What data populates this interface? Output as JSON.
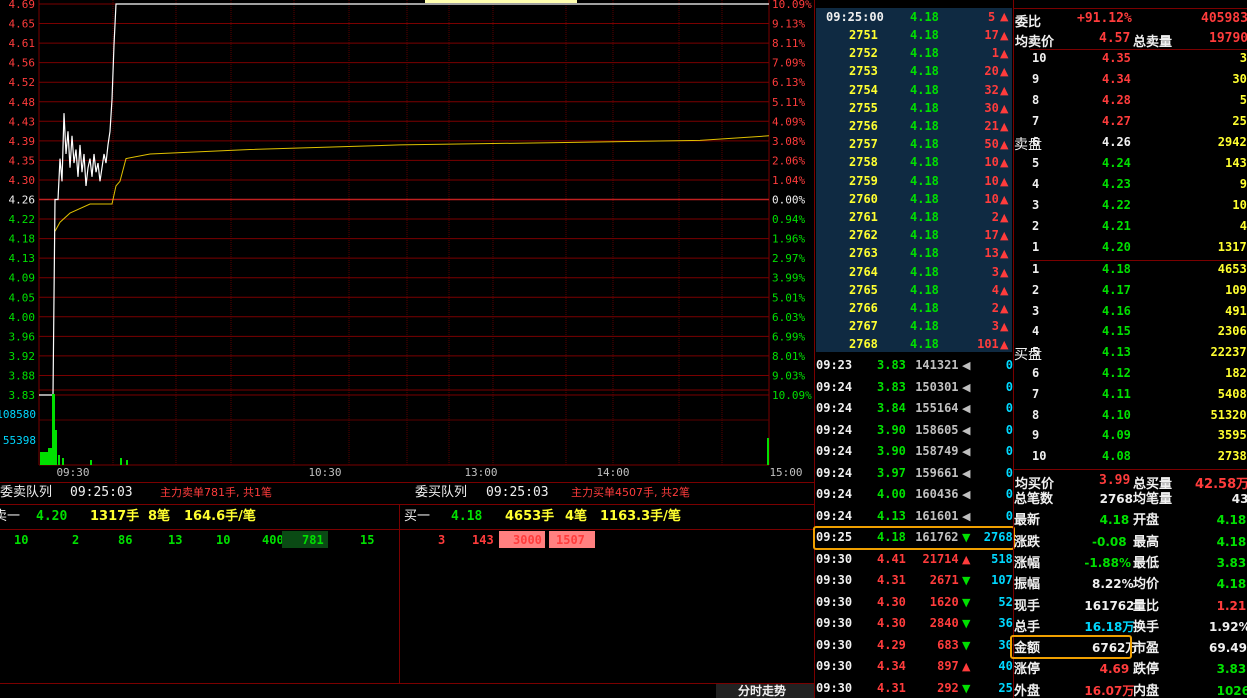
{
  "chart": {
    "left_prices": [
      "4.69",
      "4.65",
      "4.61",
      "4.56",
      "4.52",
      "4.48",
      "4.43",
      "4.39",
      "4.35",
      "4.30",
      "4.26",
      "4.22",
      "4.18",
      "4.13",
      "4.09",
      "4.05",
      "4.00",
      "3.96",
      "3.92",
      "3.88",
      "3.83"
    ],
    "right_pcts": [
      "10.09%",
      "9.13%",
      "8.11%",
      "7.09%",
      "6.13%",
      "5.11%",
      "4.09%",
      "3.08%",
      "2.06%",
      "1.04%",
      "0.00%",
      "0.94%",
      "1.96%",
      "2.97%",
      "3.99%",
      "5.01%",
      "6.03%",
      "6.99%",
      "8.01%",
      "9.03%",
      "10.09%"
    ],
    "vol_labels": [
      "108580",
      "55398"
    ],
    "time_labels": [
      "09:30",
      "10:30",
      "13:00",
      "14:00",
      "15:00"
    ],
    "prev_close": 4.26,
    "price_range": [
      3.83,
      4.69
    ]
  },
  "sell_queue": {
    "title": "委卖队列",
    "time": "09:25:03",
    "note": "主力卖单781手, 共1笔",
    "label": "卖一",
    "price": "4.20",
    "qty": "1317手",
    "count": "8笔",
    "avg": "164.6手/笔",
    "orders": [
      "10",
      "2",
      "86",
      "13",
      "10",
      "400",
      "781",
      "15"
    ]
  },
  "buy_queue": {
    "title": "委买队列",
    "time": "09:25:03",
    "note": "主力买单4507手, 共2笔",
    "label": "买一",
    "price": "4.18",
    "qty": "4653手",
    "count": "4笔",
    "avg": "1163.3手/笔",
    "orders": [
      "3",
      "143",
      "3000",
      "1507"
    ]
  },
  "trades_top": {
    "header_time": "09:25:00",
    "header_price": "4.18",
    "header_vol": "5",
    "rows": [
      [
        "2751",
        "4.18",
        "17"
      ],
      [
        "2752",
        "4.18",
        "1"
      ],
      [
        "2753",
        "4.18",
        "20"
      ],
      [
        "2754",
        "4.18",
        "32"
      ],
      [
        "2755",
        "4.18",
        "30"
      ],
      [
        "2756",
        "4.18",
        "21"
      ],
      [
        "2757",
        "4.18",
        "50"
      ],
      [
        "2758",
        "4.18",
        "10"
      ],
      [
        "2759",
        "4.18",
        "10"
      ],
      [
        "2760",
        "4.18",
        "10"
      ],
      [
        "2761",
        "4.18",
        "2"
      ],
      [
        "2762",
        "4.18",
        "17"
      ],
      [
        "2763",
        "4.18",
        "13"
      ],
      [
        "2764",
        "4.18",
        "3"
      ],
      [
        "2765",
        "4.18",
        "4"
      ],
      [
        "2766",
        "4.18",
        "2"
      ],
      [
        "2767",
        "4.18",
        "3"
      ],
      [
        "2768",
        "4.18",
        "101"
      ]
    ]
  },
  "trades_bottom": [
    {
      "time": "09:23",
      "price": "3.83",
      "vol": "141321",
      "dir": "left",
      "n": "0",
      "color": "red"
    },
    {
      "time": "09:24",
      "price": "3.83",
      "vol": "150301",
      "dir": "left",
      "n": "0",
      "color": "red"
    },
    {
      "time": "09:24",
      "price": "3.84",
      "vol": "155164",
      "dir": "left",
      "n": "0",
      "color": "red"
    },
    {
      "time": "09:24",
      "price": "3.90",
      "vol": "158605",
      "dir": "left",
      "n": "0",
      "color": "red"
    },
    {
      "time": "09:24",
      "price": "3.90",
      "vol": "158749",
      "dir": "left",
      "n": "0",
      "color": "red"
    },
    {
      "time": "09:24",
      "price": "3.97",
      "vol": "159661",
      "dir": "left",
      "n": "0",
      "color": "red"
    },
    {
      "time": "09:24",
      "price": "4.00",
      "vol": "160436",
      "dir": "left",
      "n": "0",
      "color": "red"
    },
    {
      "time": "09:24",
      "price": "4.13",
      "vol": "161601",
      "dir": "left",
      "n": "0",
      "color": "red"
    },
    {
      "time": "09:25",
      "price": "4.18",
      "vol": "161762",
      "dir": "down",
      "n": "2768",
      "color": "grn"
    },
    {
      "time": "09:30",
      "price": "4.41",
      "vol": "21714",
      "dir": "up",
      "n": "518",
      "color": "red"
    },
    {
      "time": "09:30",
      "price": "4.31",
      "vol": "2671",
      "dir": "down",
      "n": "107",
      "color": "red"
    },
    {
      "time": "09:30",
      "price": "4.30",
      "vol": "1620",
      "dir": "down",
      "n": "52",
      "color": "red"
    },
    {
      "time": "09:30",
      "price": "4.30",
      "vol": "2840",
      "dir": "down",
      "n": "36",
      "color": "red"
    },
    {
      "time": "09:30",
      "price": "4.29",
      "vol": "683",
      "dir": "down",
      "n": "30",
      "color": "red"
    },
    {
      "time": "09:30",
      "price": "4.34",
      "vol": "897",
      "dir": "up",
      "n": "40",
      "color": "red"
    },
    {
      "time": "09:30",
      "price": "4.31",
      "vol": "292",
      "dir": "down",
      "n": "25",
      "color": "red"
    }
  ],
  "order_book": {
    "wb_label": "委比",
    "wb_value": "+91.12%",
    "wb_vol": "405983",
    "avg_sell_label": "均卖价",
    "avg_sell": "4.57",
    "total_sell_label": "总卖量",
    "total_sell": "19790",
    "sell_side_label": "卖盘",
    "buy_side_label": "买盘",
    "asks": [
      [
        "10",
        "4.35",
        "3",
        "red"
      ],
      [
        "9",
        "4.34",
        "30",
        "red"
      ],
      [
        "8",
        "4.28",
        "5",
        "red"
      ],
      [
        "7",
        "4.27",
        "25",
        "red"
      ],
      [
        "6",
        "4.26",
        "2942",
        "wht"
      ],
      [
        "5",
        "4.24",
        "143",
        "grn"
      ],
      [
        "4",
        "4.23",
        "9",
        "grn"
      ],
      [
        "3",
        "4.22",
        "10",
        "grn"
      ],
      [
        "2",
        "4.21",
        "4",
        "grn"
      ],
      [
        "1",
        "4.20",
        "1317",
        "grn"
      ]
    ],
    "bids": [
      [
        "1",
        "4.18",
        "4653"
      ],
      [
        "2",
        "4.17",
        "109"
      ],
      [
        "3",
        "4.16",
        "491"
      ],
      [
        "4",
        "4.15",
        "2306"
      ],
      [
        "5",
        "4.13",
        "22237"
      ],
      [
        "6",
        "4.12",
        "182"
      ],
      [
        "7",
        "4.11",
        "5408"
      ],
      [
        "8",
        "4.10",
        "51320"
      ],
      [
        "9",
        "4.09",
        "3595"
      ],
      [
        "10",
        "4.08",
        "2738"
      ]
    ],
    "avg_buy_label": "均买价",
    "avg_buy": "3.99",
    "total_buy_label": "总买量",
    "total_buy": "42.58万"
  },
  "stats": [
    [
      "总笔数",
      "2768",
      "wht",
      "均笔量",
      "43",
      "wht"
    ],
    [
      "最新",
      "4.18",
      "grn",
      "开盘",
      "4.18",
      "grn"
    ],
    [
      "涨跌",
      "-0.08",
      "grn",
      "最高",
      "4.18",
      "grn"
    ],
    [
      "涨幅",
      "-1.88%",
      "grn",
      "最低",
      "3.83",
      "grn"
    ],
    [
      "振幅",
      "8.22%",
      "wht",
      "均价",
      "4.18",
      "grn"
    ],
    [
      "现手",
      "161762",
      "wht",
      "量比",
      "1.21",
      "red"
    ],
    [
      "总手",
      "16.18万",
      "cyan",
      "换手",
      "1.92%",
      "wht"
    ],
    [
      "金额",
      "6762万",
      "wht",
      "市盈",
      "69.49",
      "wht"
    ],
    [
      "涨停",
      "4.69",
      "red",
      "跌停",
      "3.83",
      "grn"
    ],
    [
      "外盘",
      "16.07万",
      "red",
      "内盘",
      "1026",
      "grn"
    ]
  ],
  "bottom_tab": "分时走势",
  "colors": {
    "up": "#ff3c3c",
    "down": "#00e000",
    "grid": "#7a0000",
    "price_line": "#ffffff",
    "avg_line": "#e0c000",
    "highlight": "#f0a000"
  }
}
